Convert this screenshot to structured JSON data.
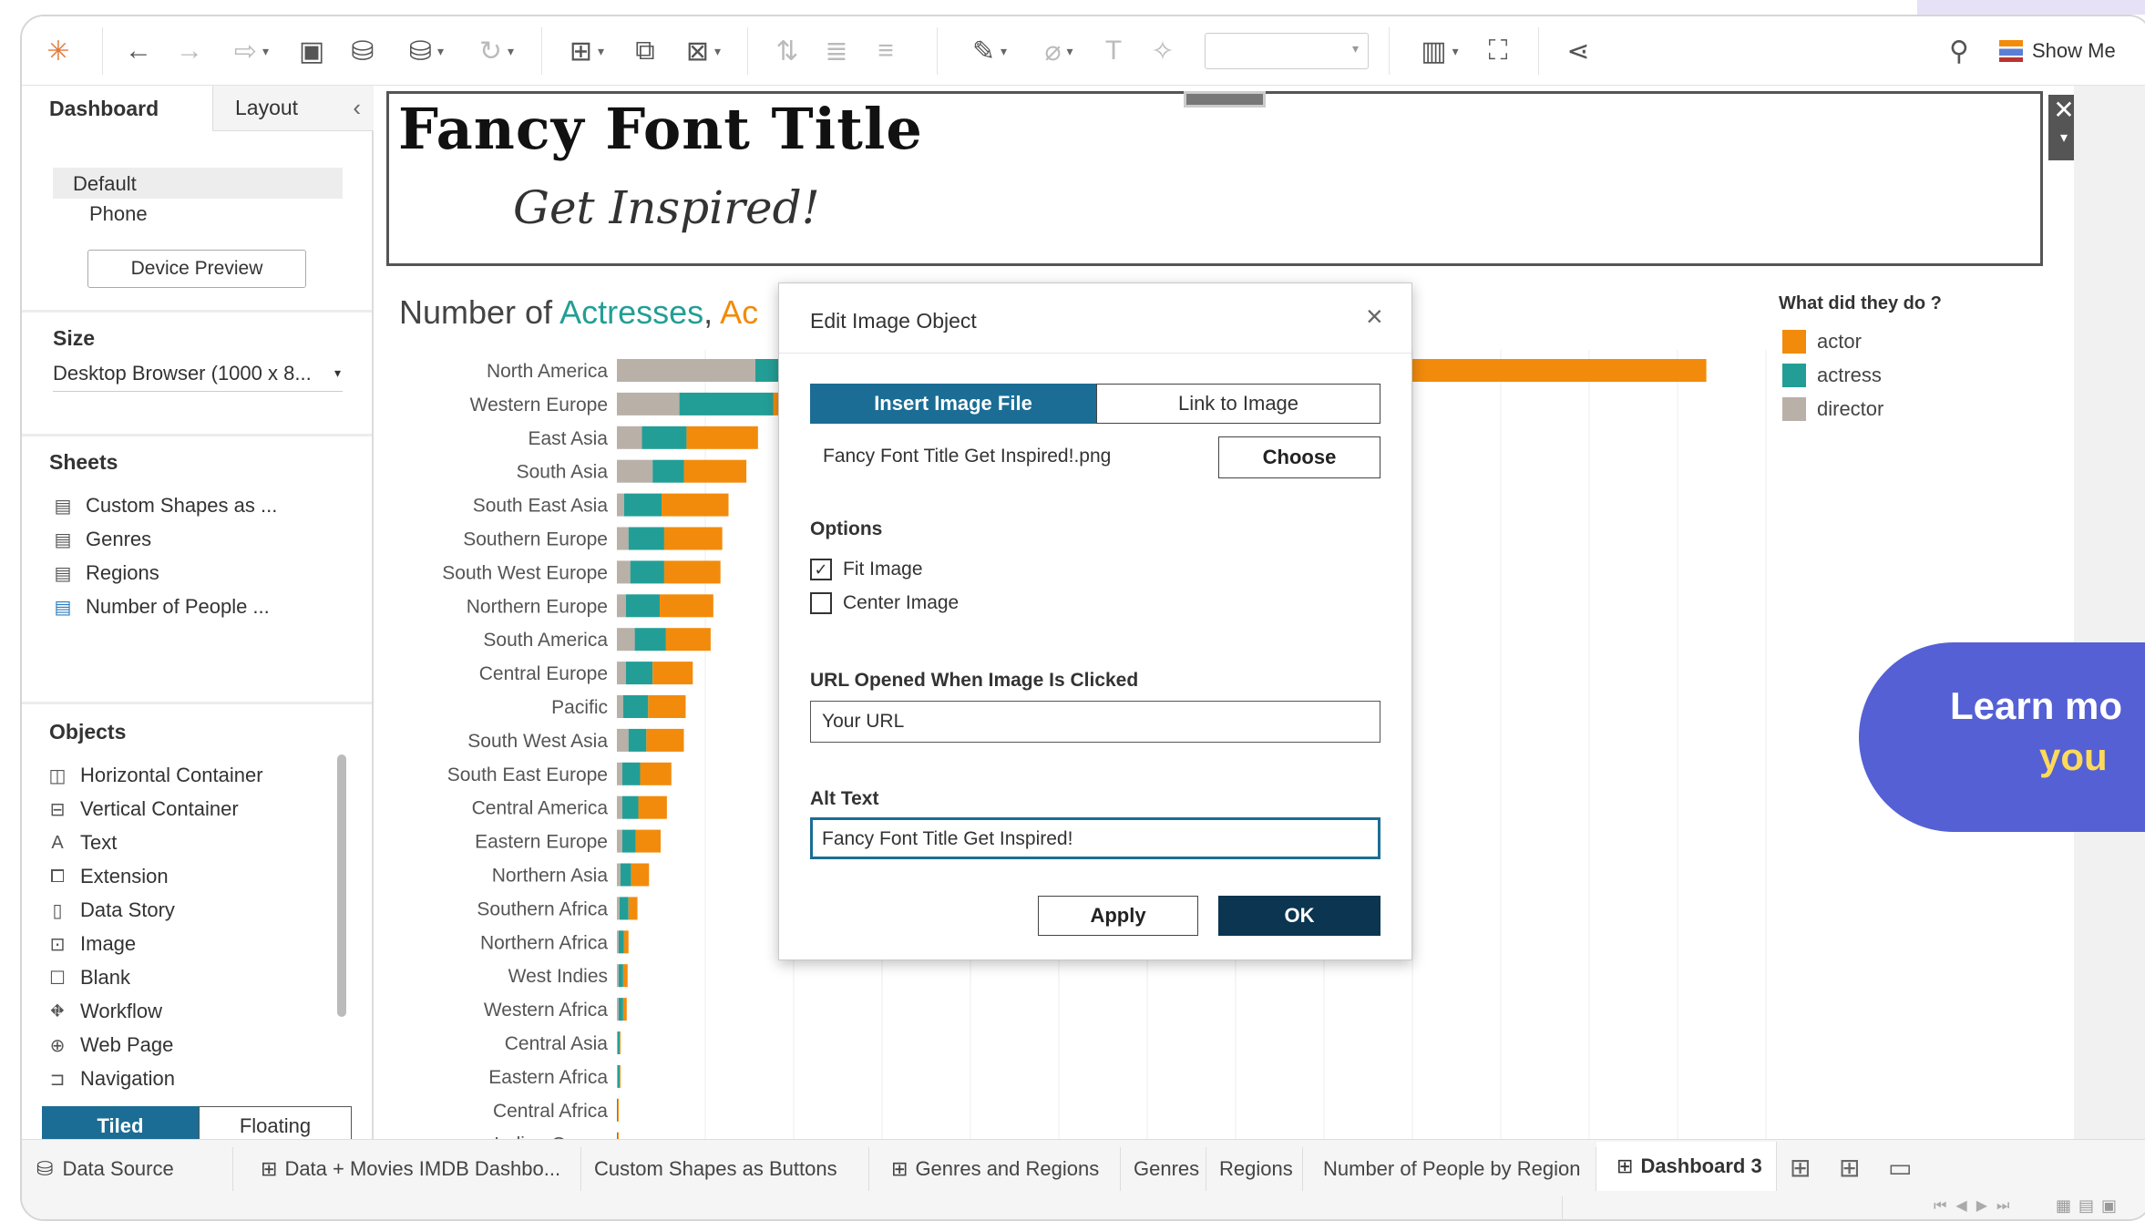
{
  "toolbar": {
    "show_me": "Show Me"
  },
  "left_panel": {
    "tabs": [
      "Dashboard",
      "Layout"
    ],
    "device_options": [
      "Default",
      "Phone"
    ],
    "device_preview_btn": "Device Preview",
    "size_label": "Size",
    "size_value": "Desktop Browser (1000 x 8...",
    "sheets_label": "Sheets",
    "sheets": [
      "Custom Shapes as ...",
      "Genres",
      "Regions",
      "Number of People ..."
    ],
    "objects_label": "Objects",
    "objects": [
      "Horizontal Container",
      "Vertical Container",
      "Text",
      "Extension",
      "Data Story",
      "Image",
      "Blank",
      "Workflow",
      "Web Page",
      "Navigation"
    ],
    "tiled": "Tiled",
    "floating": "Floating"
  },
  "canvas": {
    "title": "Fancy Font Title",
    "subtitle": "Get Inspired!",
    "chart_title_prefix": "Number of ",
    "chart_title_actresses": "Actresses",
    "chart_title_sep": ", ",
    "chart_title_actors": "Ac"
  },
  "legend": {
    "title": "What did they do ?",
    "items": [
      {
        "label": "actor",
        "color": "#f28b0c"
      },
      {
        "label": "actress",
        "color": "#239e96"
      },
      {
        "label": "director",
        "color": "#b9b0a8"
      }
    ]
  },
  "chart_data": {
    "type": "bar",
    "orientation": "horizontal-stacked",
    "categories": [
      "North America",
      "Western Europe",
      "East Asia",
      "South Asia",
      "South East Asia",
      "Southern Europe",
      "South West Europe",
      "Northern Europe",
      "South America",
      "Central Europe",
      "Pacific",
      "South West Asia",
      "South East Europe",
      "Central America",
      "Eastern Europe",
      "Northern Asia",
      "Southern Africa",
      "Northern Africa",
      "West Indies",
      "Western Africa",
      "Central Asia",
      "Eastern Africa",
      "Central Africa",
      "Indian Ocean"
    ],
    "series": [
      {
        "name": "director",
        "color": "#b9b0a8",
        "values": [
          155,
          70,
          28,
          40,
          8,
          13,
          15,
          10,
          20,
          10,
          7,
          13,
          6,
          6,
          6,
          4,
          3,
          2,
          2,
          2,
          1,
          1,
          0,
          0
        ]
      },
      {
        "name": "actress",
        "color": "#239e96",
        "values": [
          45,
          105,
          50,
          35,
          42,
          40,
          38,
          38,
          35,
          30,
          28,
          20,
          20,
          18,
          15,
          12,
          10,
          6,
          5,
          5,
          2,
          2,
          1,
          1
        ]
      },
      {
        "name": "actor",
        "color": "#f28b0c",
        "values": [
          1020,
          90,
          80,
          70,
          75,
          65,
          63,
          60,
          50,
          45,
          42,
          42,
          35,
          32,
          28,
          20,
          10,
          5,
          5,
          4,
          1,
          1,
          1,
          1
        ]
      }
    ]
  },
  "dialog": {
    "title": "Edit Image Object",
    "tab_insert": "Insert Image File",
    "tab_link": "Link to Image",
    "file_name": "Fancy Font Title Get Inspired!.png",
    "choose": "Choose",
    "options_label": "Options",
    "fit_image": "Fit Image",
    "center_image": "Center Image",
    "url_label": "URL Opened When Image Is Clicked",
    "url_value": "Your URL",
    "alt_label": "Alt Text",
    "alt_value": "Fancy Font Title Get Inspired!",
    "apply": "Apply",
    "ok": "OK"
  },
  "bottom_tabs": [
    "Data Source",
    "Data + Movies IMDB Dashbo...",
    "Custom Shapes as Buttons",
    "Genres and Regions",
    "Genres",
    "Regions",
    "Number of People by Region",
    "Dashboard 3"
  ],
  "promo": {
    "line1": "Learn mo",
    "line2": "you"
  }
}
